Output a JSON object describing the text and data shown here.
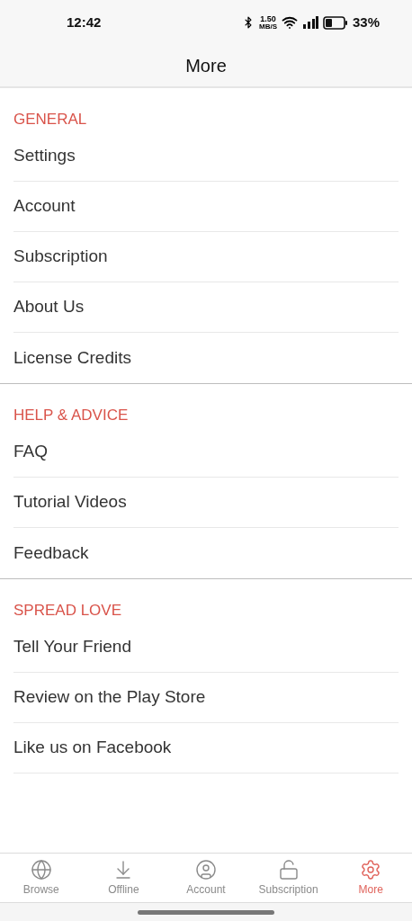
{
  "status_bar": {
    "time": "12:42",
    "speed_value": "1.50",
    "speed_unit": "MB/S",
    "battery": "33%"
  },
  "header": {
    "title": "More"
  },
  "sections": [
    {
      "title": "GENERAL",
      "items": [
        "Settings",
        "Account",
        "Subscription",
        "About Us",
        "License Credits"
      ]
    },
    {
      "title": "HELP & ADVICE",
      "items": [
        "FAQ",
        "Tutorial Videos",
        "Feedback"
      ]
    },
    {
      "title": "SPREAD LOVE",
      "items": [
        "Tell Your Friend",
        "Review on the Play Store",
        "Like us on Facebook"
      ]
    }
  ],
  "bottom_nav": [
    {
      "kind": "browse",
      "label": "Browse",
      "selected": false
    },
    {
      "kind": "offline",
      "label": "Offline",
      "selected": false
    },
    {
      "kind": "account",
      "label": "Account",
      "selected": false
    },
    {
      "kind": "subscription",
      "label": "Subscription",
      "selected": false
    },
    {
      "kind": "more",
      "label": "More",
      "selected": true
    }
  ]
}
